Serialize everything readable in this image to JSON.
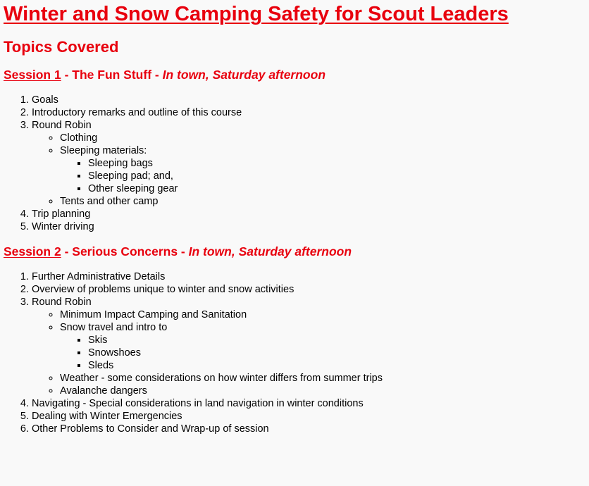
{
  "title": "Winter and Snow Camping Safety for Scout Leaders",
  "topics_heading": "Topics Covered",
  "sessions": [
    {
      "link_label": "Session 1",
      "sep1": " - ",
      "subtitle": "The Fun Stuff",
      "sep2": " - ",
      "place": "In town, Saturday afternoon",
      "items": [
        {
          "text": "Goals"
        },
        {
          "text": "Introductory remarks and outline of this course"
        },
        {
          "text": "Round Robin"
        },
        {
          "text": "Clothing"
        },
        {
          "text": "Sleeping materials:"
        },
        {
          "text": "Sleeping bags"
        },
        {
          "text": "Sleeping pad; and,"
        },
        {
          "text": "Other sleeping gear"
        },
        {
          "text": "Tents and other camp"
        },
        {
          "text": "Trip planning"
        },
        {
          "text": "Winter driving"
        }
      ]
    },
    {
      "link_label": "Session 2",
      "sep1": " - ",
      "subtitle": "Serious Concerns",
      "sep2": " - ",
      "place": "In town, Saturday afternoon",
      "items": [
        {
          "text": "Further Administrative Details"
        },
        {
          "text": "Overview of problems unique to winter and snow activities"
        },
        {
          "text": "Round Robin"
        },
        {
          "text": "Minimum Impact Camping and Sanitation"
        },
        {
          "text": "Snow travel and intro to"
        },
        {
          "text": "Skis"
        },
        {
          "text": "Snowshoes"
        },
        {
          "text": "Sleds"
        },
        {
          "text": "Weather - some considerations on how winter differs from summer trips"
        },
        {
          "text": "Avalanche dangers"
        },
        {
          "text": "Navigating - Special considerations in land navigation in winter conditions"
        },
        {
          "text": "Dealing with Winter Emergencies"
        },
        {
          "text": "Other Problems to Consider and Wrap-up of session"
        }
      ]
    }
  ],
  "colors": {
    "heading": "#e8000e",
    "background": "#f9f9f9",
    "text": "#000000"
  }
}
